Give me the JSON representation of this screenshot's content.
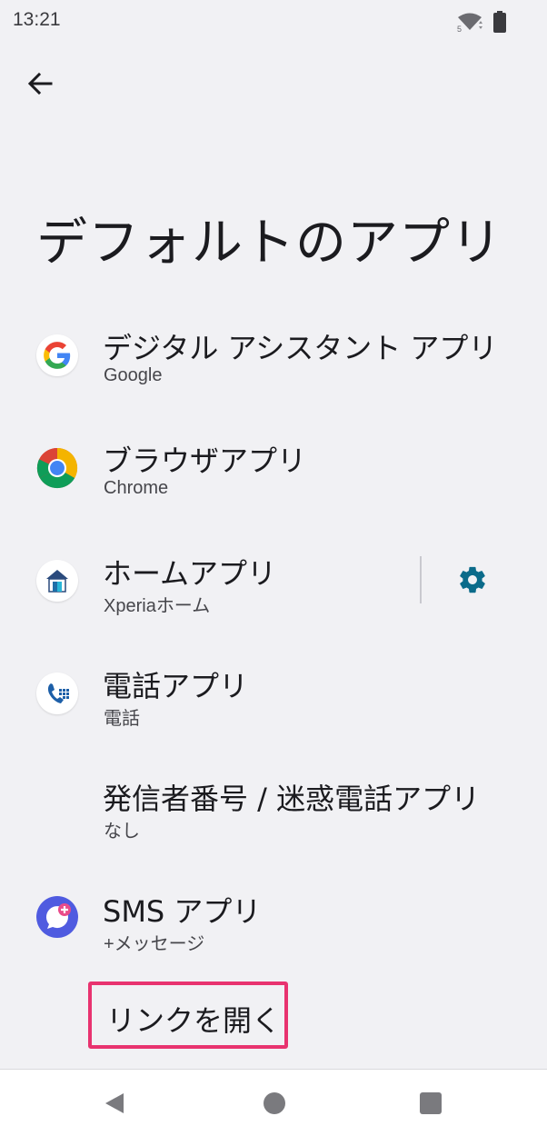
{
  "status_bar": {
    "time": "13:21",
    "wifi_label": "5",
    "icons": [
      "wifi-icon",
      "battery-icon"
    ]
  },
  "header": {
    "back_icon": "arrow-left-icon",
    "title": "デフォルトのアプリ"
  },
  "items": [
    {
      "title": "デジタル アシスタント アプリ",
      "subtitle": "Google",
      "icon": "google-icon"
    },
    {
      "title": "ブラウザアプリ",
      "subtitle": "Chrome",
      "icon": "chrome-icon"
    },
    {
      "title": "ホームアプリ",
      "subtitle": "Xperiaホーム",
      "icon": "xperia-home-icon",
      "settings_icon": "gear-icon"
    },
    {
      "title": "電話アプリ",
      "subtitle": "電話",
      "icon": "phone-icon"
    },
    {
      "title": "発信者番号 / 迷惑電話アプリ",
      "subtitle": "なし"
    },
    {
      "title": "SMS アプリ",
      "subtitle": "+メッセージ",
      "icon": "plus-message-icon"
    },
    {
      "title": "リンクを開く"
    }
  ],
  "colors": {
    "background": "#f1f1f4",
    "accent": "#0b6b8a",
    "highlight": "#e8336f"
  },
  "nav_bar": {
    "icons": [
      "nav-back-icon",
      "nav-home-icon",
      "nav-recents-icon"
    ]
  }
}
